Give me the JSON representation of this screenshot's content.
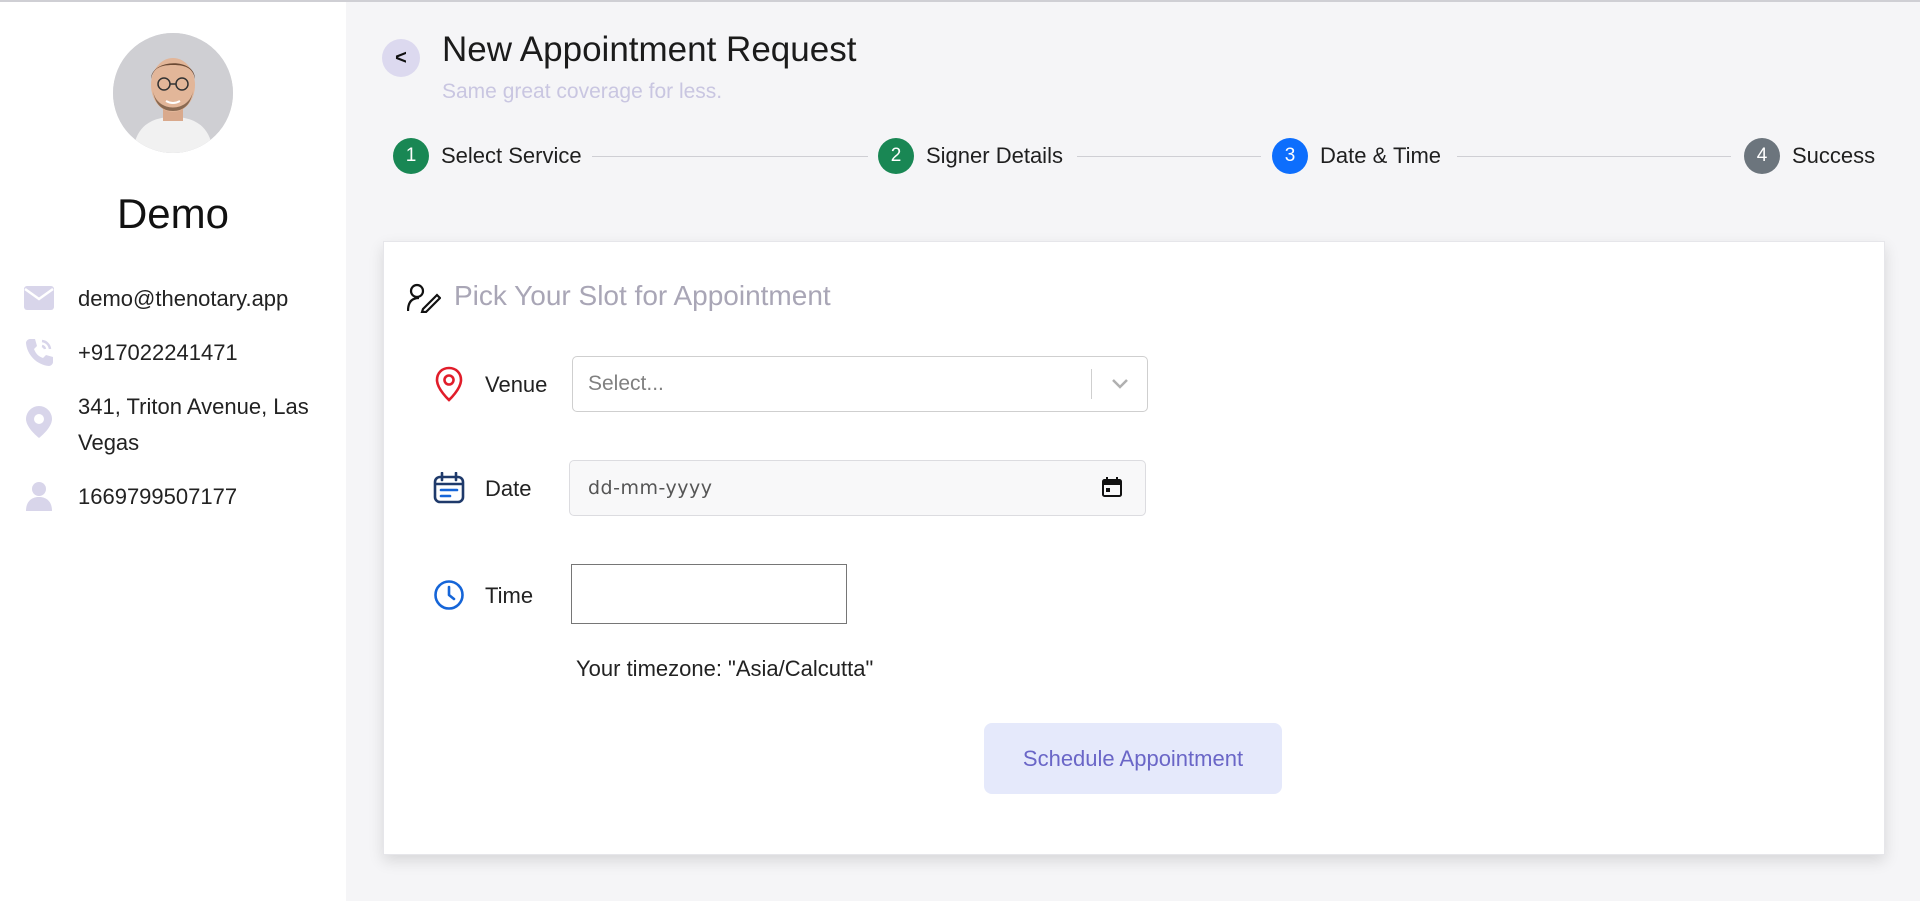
{
  "profile": {
    "name": "Demo",
    "email": "demo@thenotary.app",
    "phone": "+917022241471",
    "address": "341, Triton Avenue, Las Vegas",
    "user_id": "1669799507177"
  },
  "header": {
    "back_label": "<",
    "title": "New Appointment Request",
    "subtitle": "Same great coverage for less."
  },
  "steps": [
    {
      "number": "1",
      "label": "Select Service",
      "color": "#198754"
    },
    {
      "number": "2",
      "label": "Signer Details",
      "color": "#198754"
    },
    {
      "number": "3",
      "label": "Date & Time",
      "color": "#0d6efd"
    },
    {
      "number": "4",
      "label": "Success",
      "color": "#6c757d"
    }
  ],
  "form": {
    "title": "Pick Your Slot for Appointment",
    "venue_label": "Venue",
    "venue_placeholder": "Select...",
    "date_label": "Date",
    "date_placeholder": "dd-mm-yyyy",
    "time_label": "Time",
    "time_value": "",
    "timezone_text": "Your timezone: \"Asia/Calcutta\"",
    "submit_label": "Schedule Appointment"
  },
  "colors": {
    "accent_icon": "#e11d2a",
    "calendar_icon": "#1f3a6b",
    "clock_icon": "#1565d8",
    "button_bg": "#e5e9fb",
    "button_text": "#6a66c7"
  }
}
